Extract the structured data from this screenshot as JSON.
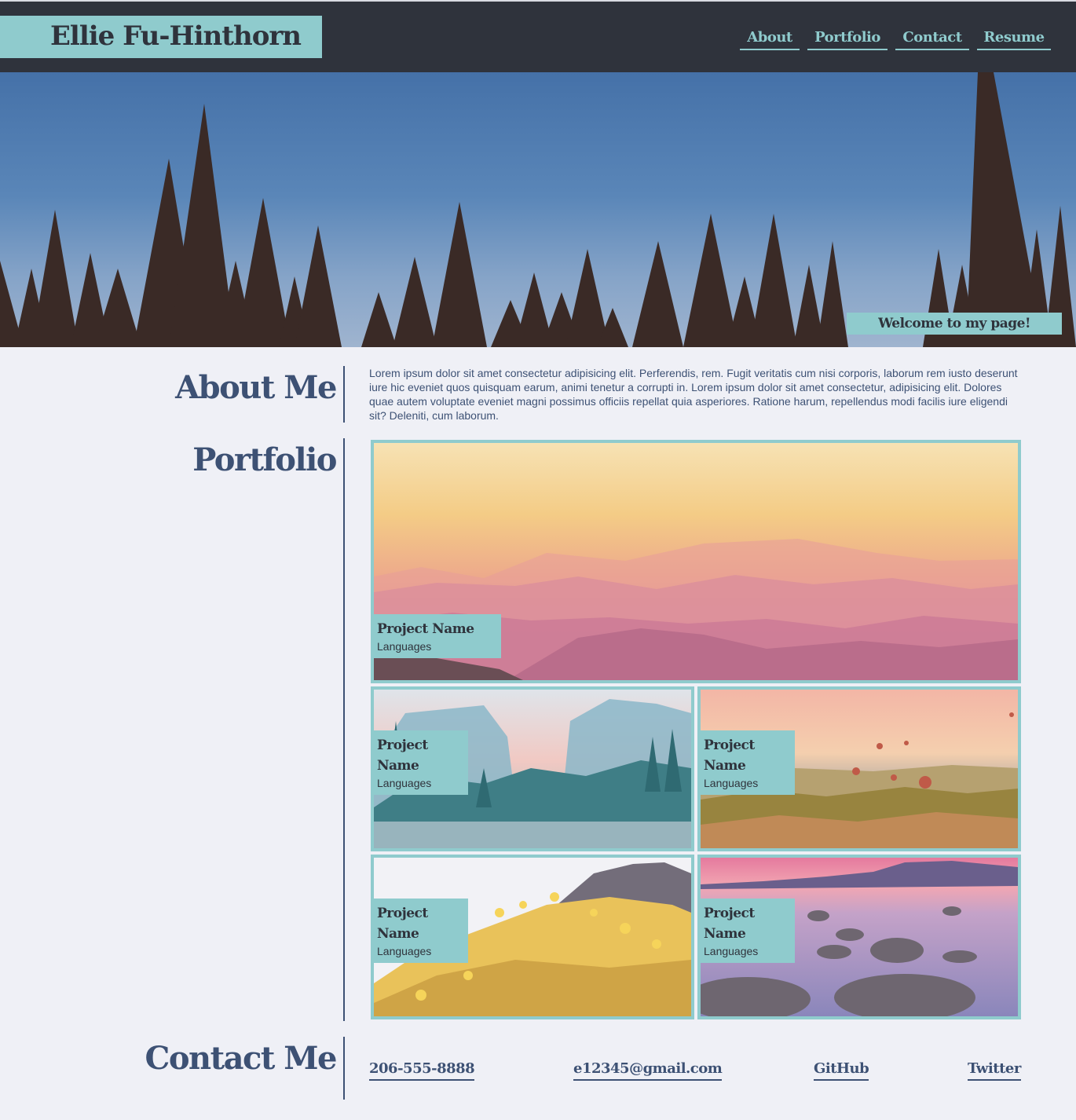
{
  "header": {
    "name": "Ellie Fu-Hinthorn",
    "nav": [
      "About",
      "Portfolio",
      "Contact",
      "Resume"
    ]
  },
  "hero": {
    "welcome": "Welcome to my page!"
  },
  "about": {
    "title": "About Me",
    "text": "Lorem ipsum dolor sit amet consectetur adipisicing elit. Perferendis, rem. Fugit veritatis cum nisi corporis, laborum rem iusto deserunt iure hic eveniet quos quisquam earum, animi tenetur a corrupti in. Lorem ipsum dolor sit amet consectetur, adipisicing elit. Dolores quae autem voluptate eveniet magni possimus officiis repellat quia asperiores. Ratione harum, repellendus modi facilis iure eligendi sit? Deleniti, cum laborum."
  },
  "portfolio": {
    "title": "Portfolio",
    "projects": [
      {
        "name": "Project Name",
        "languages": "Languages",
        "image": "mountain-sunset-image"
      },
      {
        "name": "Project Name",
        "languages": "Languages",
        "image": "valley-river-image"
      },
      {
        "name": "Project Name",
        "languages": "Languages",
        "image": "hot-air-balloons-image"
      },
      {
        "name": "Project Name",
        "languages": "Languages",
        "image": "wildflowers-image"
      },
      {
        "name": "Project Name",
        "languages": "Languages",
        "image": "lake-rocks-image"
      }
    ]
  },
  "contact": {
    "title": "Contact Me",
    "phone": "206-555-8888",
    "email": "e12345@gmail.com",
    "github": "GitHub",
    "twitter": "Twitter"
  },
  "colors": {
    "header_bg": "#2f333c",
    "accent": "#8fcbcd",
    "page_bg": "#eff0f6",
    "heading": "#3d5174"
  }
}
